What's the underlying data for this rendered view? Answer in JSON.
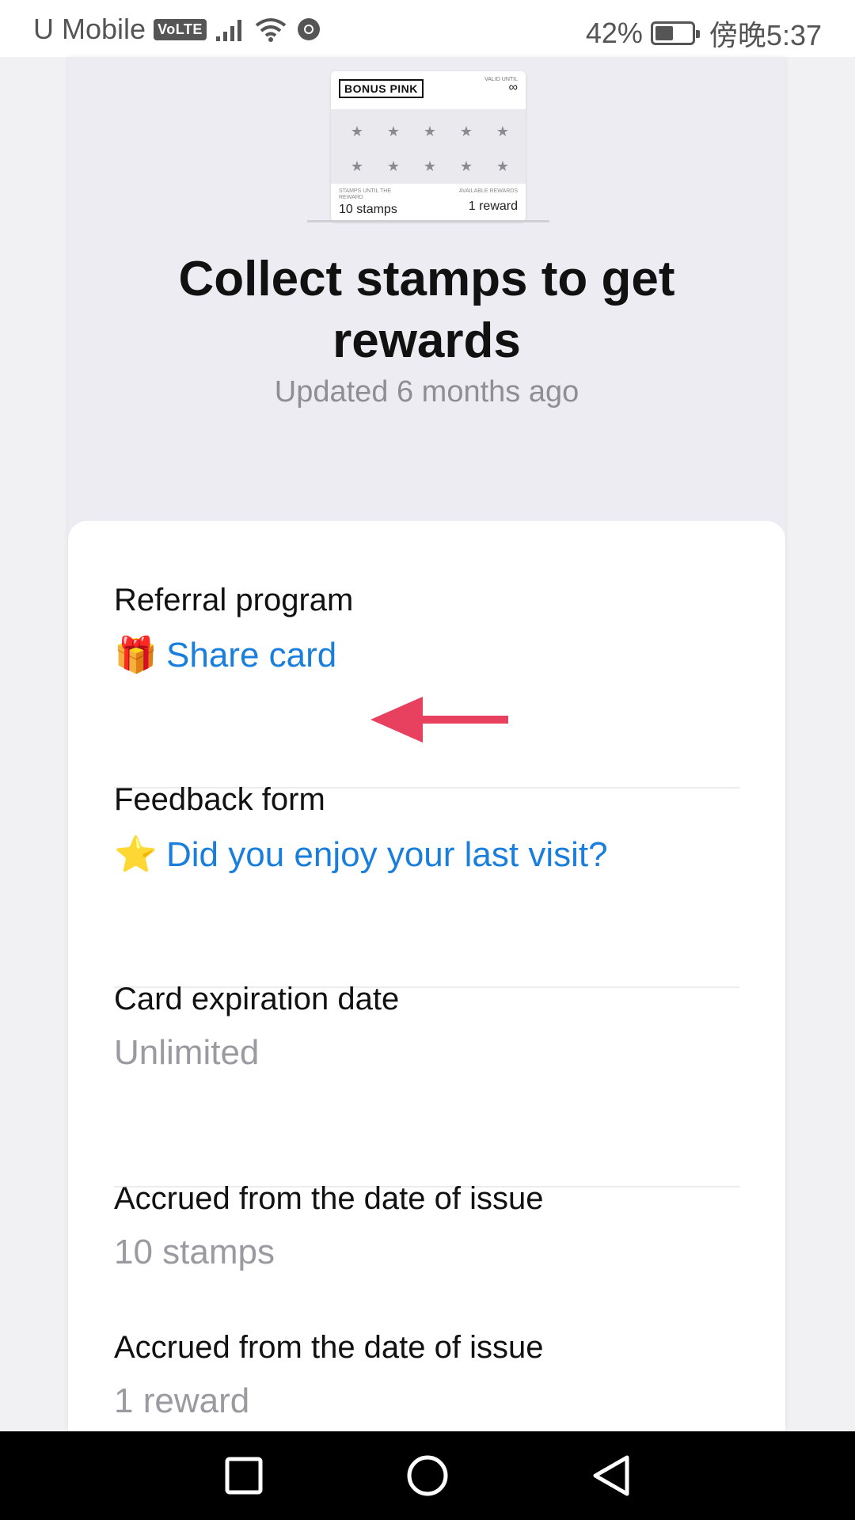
{
  "status_bar": {
    "carrier": "U Mobile",
    "volte": "VoLTE",
    "battery_percent": "42%",
    "time": "傍晚5:37"
  },
  "mini_card": {
    "brand": "BONUS PINK",
    "valid_until_label": "VALID UNTIL",
    "valid_until_value": "∞",
    "stamps_label": "STAMPS UNTIL THE REWARD",
    "stamps_value": "10 stamps",
    "rewards_label": "AVAILABLE REWARDS",
    "rewards_value": "1 reward",
    "star_icon": "★"
  },
  "hero": {
    "title": "Collect stamps to get rewards",
    "updated": "Updated 6 months ago"
  },
  "details": {
    "referral_label": "Referral program",
    "referral_emoji": "🎁",
    "referral_link": "Share card",
    "feedback_label": "Feedback form",
    "feedback_emoji": "⭐",
    "feedback_link": "Did you enjoy your last visit?",
    "expiration_label": "Card expiration date",
    "expiration_value": "Unlimited",
    "accrued_stamps_label": "Accrued from the date of issue",
    "accrued_stamps_value": "10 stamps",
    "accrued_rewards_label": "Accrued from the date of issue",
    "accrued_rewards_value": "1 reward"
  },
  "colors": {
    "link": "#1a7fdc",
    "arrow": "#e8415f"
  },
  "nav": {
    "recent_icon": "square-icon",
    "home_icon": "circle-icon",
    "back_icon": "triangle-back-icon"
  }
}
